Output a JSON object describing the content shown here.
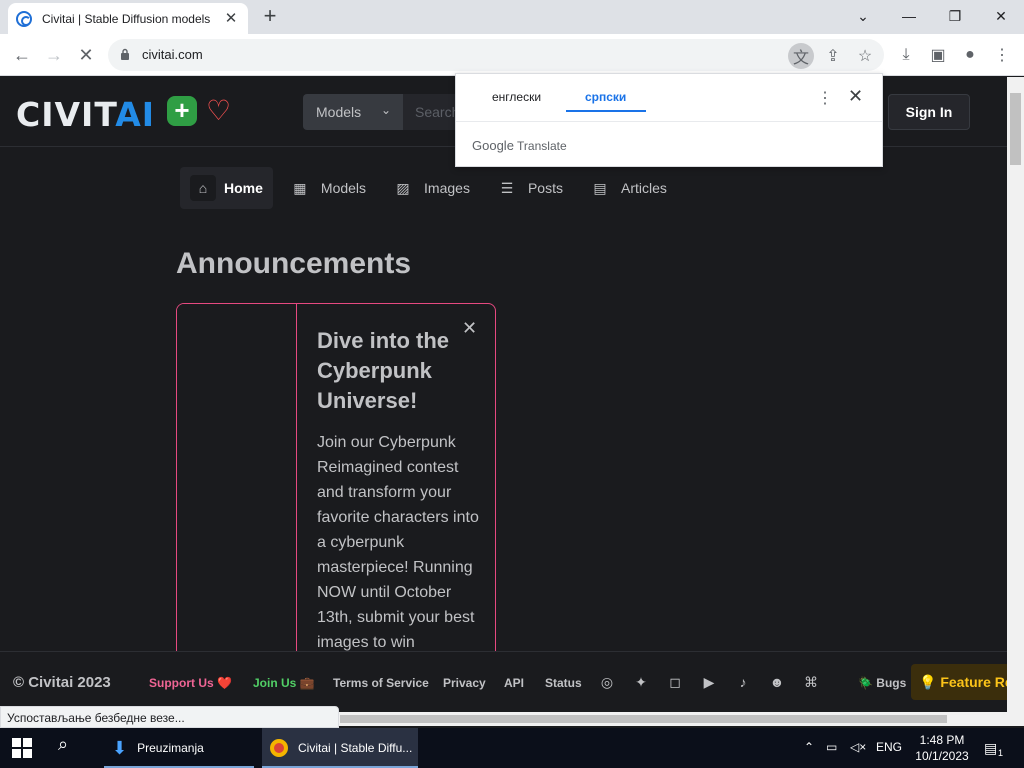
{
  "browser": {
    "tab_title": "Civitai | Stable Diffusion models",
    "new_tab": "+",
    "url": "civitai.com",
    "status_text": "Успостављање безбедне везе..."
  },
  "translate_popup": {
    "source_lang": "енглески",
    "target_lang": "српски",
    "branding_google": "Google",
    "branding_translate": "Translate"
  },
  "site": {
    "logo_civ": "CIVIT",
    "logo_ai": "AI",
    "search": {
      "category": "Models",
      "placeholder": "Search"
    },
    "sign_in": "Sign In",
    "nav": [
      {
        "label": "Home",
        "icon": "home-icon"
      },
      {
        "label": "Models",
        "icon": "grid-icon"
      },
      {
        "label": "Images",
        "icon": "photo-icon"
      },
      {
        "label": "Posts",
        "icon": "layout-list-icon"
      },
      {
        "label": "Articles",
        "icon": "file-text-icon"
      }
    ],
    "announcements_title": "Announcements",
    "announcement": {
      "title": "Dive into the Cyberpunk Universe!",
      "body": "Join our Cyberpunk Reimagined contest and transform your favorite characters into a cyberpunk masterpiece! Running NOW until October 13th, submit your best images to win"
    },
    "footer": {
      "copyright": "© Civitai 2023",
      "support": "Support Us ❤️",
      "join": "Join Us 💼",
      "terms": "Terms of Service",
      "privacy": "Privacy",
      "api": "API",
      "status": "Status",
      "bugs": "🪲 Bugs",
      "feature": "💡 Feature Requests"
    }
  },
  "taskbar": {
    "task1": "Preuzimanja",
    "task2": "Civitai | Stable Diffu...",
    "lang": "ENG",
    "time": "1:48 PM",
    "date": "10/1/2023",
    "notif_count": "1"
  },
  "colors": {
    "page_bg": "#1a1b1e",
    "accent_blue": "#228be6",
    "accent_pink": "#e64980",
    "plus_green": "#2f9e44",
    "feature_yellow": "#fcc419"
  }
}
